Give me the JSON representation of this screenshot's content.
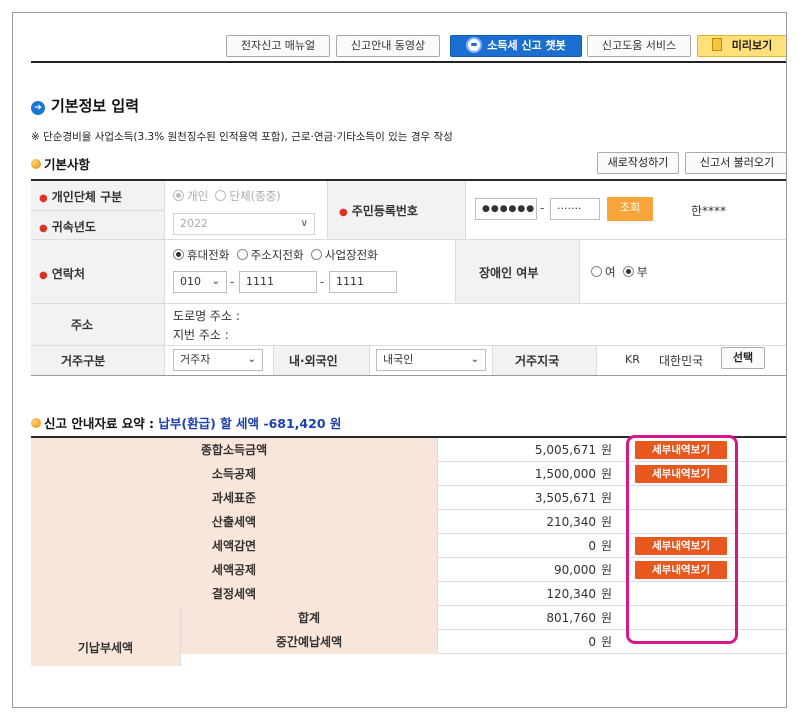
{
  "toolbar": {
    "manual": "전자신고 매뉴얼",
    "video": "신고안내 동영상",
    "chatbot": "소득세 신고 챗봇",
    "help": "신고도움 서비스",
    "preview": "미리보기"
  },
  "section": {
    "title": "기본정보 입력",
    "note": "※ 단순경비율 사업소득(3.3% 원천징수된 인적용역 포함), 근로·연금·기타소득이 있는 경우 작성"
  },
  "basic": {
    "title": "기본사항",
    "new_button": "새로작성하기",
    "load_button": "신고서 불러오기",
    "type_label": "개인단체 구분",
    "type_options": [
      "개인",
      "단체(종중)"
    ],
    "year_label": "귀속년도",
    "year_value": "2022",
    "rrn_label": "주민등록번호",
    "rrn_front": "●●●●●●",
    "rrn_dash": "-",
    "rrn_back": "·······",
    "lookup_button": "조회",
    "name_value": "한****",
    "contact_label": "연락처",
    "contact_options": [
      "휴대전화",
      "주소지전화",
      "사업장전화"
    ],
    "phone_prefix": "010",
    "phone_mid": "1111",
    "phone_last": "1111",
    "disabled_label": "장애인 여부",
    "disabled_yes": "여",
    "disabled_no": "부",
    "address_label": "주소",
    "road_address": "도로명 주소 :",
    "lot_address": "지번 주소 :",
    "residence_label": "거주구분",
    "residence_value": "거주자",
    "nationality_label": "내·외국인",
    "nationality_value": "내국인",
    "country_label": "거주지국",
    "country_code": "KR",
    "country_name": "대한민국",
    "select_button": "선택"
  },
  "summary": {
    "title_prefix": "신고 안내자료 요약 : ",
    "title_amount": "납부(환급) 할 세액 -681,420 원",
    "unit": "원",
    "detail_label": "세부내역보기",
    "rows": [
      {
        "label": "종합소득금액",
        "value": "5,005,671"
      },
      {
        "label": "소득공제",
        "value": "1,500,000"
      },
      {
        "label": "과세표준",
        "value": "3,505,671"
      },
      {
        "label": "산출세액",
        "value": "210,340"
      },
      {
        "label": "세액감면",
        "value": "0"
      },
      {
        "label": "세액공제",
        "value": "90,000"
      },
      {
        "label": "결정세액",
        "value": "120,340"
      }
    ],
    "prepaid_label": "기납부세액",
    "prepaid_rows": [
      {
        "label": "합계",
        "value": "801,760"
      },
      {
        "label": "중간예납세액",
        "value": "0"
      }
    ]
  },
  "colors": {
    "accent_blue": "#1c6fd1",
    "detail_orange": "#e8571e",
    "highlight_magenta": "#d6188a",
    "summary_label_bg": "#f8e6da"
  }
}
